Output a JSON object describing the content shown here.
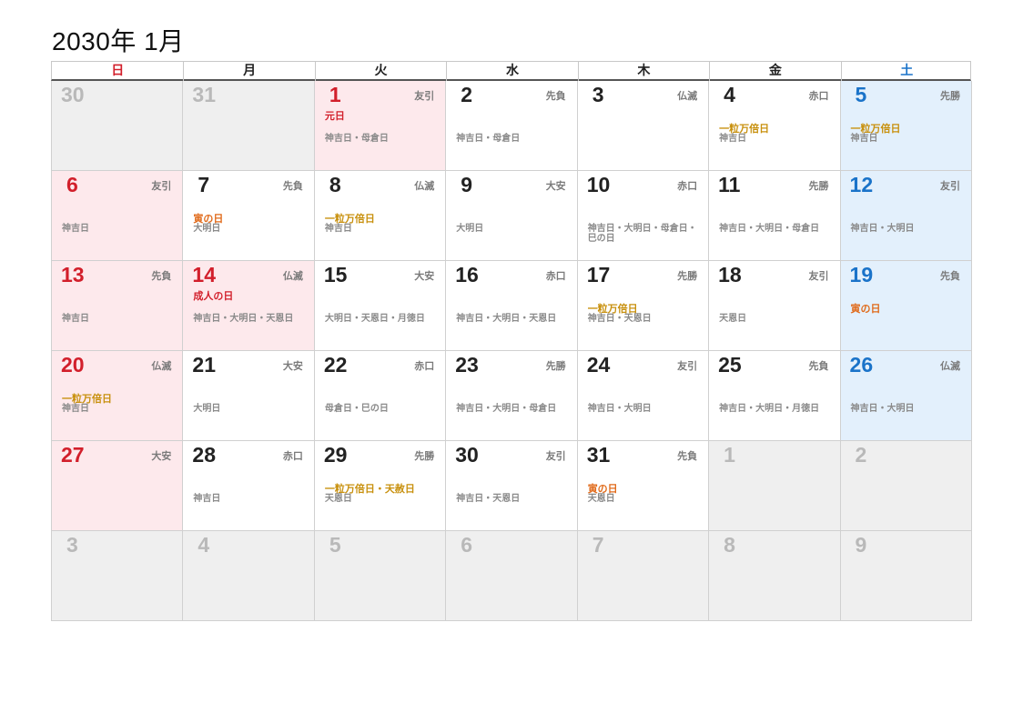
{
  "title": "2030年 1月",
  "weekdays": [
    "日",
    "月",
    "火",
    "水",
    "木",
    "金",
    "土"
  ],
  "cells": [
    {
      "day": "30",
      "type": "other",
      "rokuyo": "",
      "holiday": "",
      "tag": "",
      "tag_color": "",
      "notes": ""
    },
    {
      "day": "31",
      "type": "other",
      "rokuyo": "",
      "holiday": "",
      "tag": "",
      "tag_color": "",
      "notes": ""
    },
    {
      "day": "1",
      "type": "holiday",
      "rokuyo": "友引",
      "holiday": "元日",
      "tag": "",
      "tag_color": "",
      "notes": "神吉日・母倉日"
    },
    {
      "day": "2",
      "type": "normal",
      "rokuyo": "先負",
      "holiday": "",
      "tag": "",
      "tag_color": "",
      "notes": "神吉日・母倉日"
    },
    {
      "day": "3",
      "type": "normal",
      "rokuyo": "仏滅",
      "holiday": "",
      "tag": "",
      "tag_color": "",
      "notes": ""
    },
    {
      "day": "4",
      "type": "normal",
      "rokuyo": "赤口",
      "holiday": "",
      "tag": "一粒万倍日",
      "tag_color": "gold",
      "notes": "神吉日"
    },
    {
      "day": "5",
      "type": "saturday",
      "rokuyo": "先勝",
      "holiday": "",
      "tag": "一粒万倍日",
      "tag_color": "gold",
      "notes": "神吉日"
    },
    {
      "day": "6",
      "type": "sunday",
      "rokuyo": "友引",
      "holiday": "",
      "tag": "",
      "tag_color": "",
      "notes": "神吉日"
    },
    {
      "day": "7",
      "type": "normal",
      "rokuyo": "先負",
      "holiday": "",
      "tag": "寅の日",
      "tag_color": "orange",
      "notes": "大明日"
    },
    {
      "day": "8",
      "type": "normal",
      "rokuyo": "仏滅",
      "holiday": "",
      "tag": "一粒万倍日",
      "tag_color": "gold",
      "notes": "神吉日"
    },
    {
      "day": "9",
      "type": "normal",
      "rokuyo": "大安",
      "holiday": "",
      "tag": "",
      "tag_color": "",
      "notes": "大明日"
    },
    {
      "day": "10",
      "type": "normal",
      "rokuyo": "赤口",
      "holiday": "",
      "tag": "",
      "tag_color": "",
      "notes": "神吉日・大明日・母倉日・巳の日"
    },
    {
      "day": "11",
      "type": "normal",
      "rokuyo": "先勝",
      "holiday": "",
      "tag": "",
      "tag_color": "",
      "notes": "神吉日・大明日・母倉日"
    },
    {
      "day": "12",
      "type": "saturday",
      "rokuyo": "友引",
      "holiday": "",
      "tag": "",
      "tag_color": "",
      "notes": "神吉日・大明日"
    },
    {
      "day": "13",
      "type": "sunday",
      "rokuyo": "先負",
      "holiday": "",
      "tag": "",
      "tag_color": "",
      "notes": "神吉日"
    },
    {
      "day": "14",
      "type": "holiday",
      "rokuyo": "仏滅",
      "holiday": "成人の日",
      "tag": "",
      "tag_color": "",
      "notes": "神吉日・大明日・天恩日"
    },
    {
      "day": "15",
      "type": "normal",
      "rokuyo": "大安",
      "holiday": "",
      "tag": "",
      "tag_color": "",
      "notes": "大明日・天恩日・月徳日"
    },
    {
      "day": "16",
      "type": "normal",
      "rokuyo": "赤口",
      "holiday": "",
      "tag": "",
      "tag_color": "",
      "notes": "神吉日・大明日・天恩日"
    },
    {
      "day": "17",
      "type": "normal",
      "rokuyo": "先勝",
      "holiday": "",
      "tag": "一粒万倍日",
      "tag_color": "gold",
      "notes": "神吉日・天恩日"
    },
    {
      "day": "18",
      "type": "normal",
      "rokuyo": "友引",
      "holiday": "",
      "tag": "",
      "tag_color": "",
      "notes": "天恩日"
    },
    {
      "day": "19",
      "type": "saturday",
      "rokuyo": "先負",
      "holiday": "",
      "tag": "寅の日",
      "tag_color": "orange",
      "notes": ""
    },
    {
      "day": "20",
      "type": "sunday",
      "rokuyo": "仏滅",
      "holiday": "",
      "tag": "一粒万倍日",
      "tag_color": "gold",
      "notes": "神吉日"
    },
    {
      "day": "21",
      "type": "normal",
      "rokuyo": "大安",
      "holiday": "",
      "tag": "",
      "tag_color": "",
      "notes": "大明日"
    },
    {
      "day": "22",
      "type": "normal",
      "rokuyo": "赤口",
      "holiday": "",
      "tag": "",
      "tag_color": "",
      "notes": "母倉日・巳の日"
    },
    {
      "day": "23",
      "type": "normal",
      "rokuyo": "先勝",
      "holiday": "",
      "tag": "",
      "tag_color": "",
      "notes": "神吉日・大明日・母倉日"
    },
    {
      "day": "24",
      "type": "normal",
      "rokuyo": "友引",
      "holiday": "",
      "tag": "",
      "tag_color": "",
      "notes": "神吉日・大明日"
    },
    {
      "day": "25",
      "type": "normal",
      "rokuyo": "先負",
      "holiday": "",
      "tag": "",
      "tag_color": "",
      "notes": "神吉日・大明日・月徳日"
    },
    {
      "day": "26",
      "type": "saturday",
      "rokuyo": "仏滅",
      "holiday": "",
      "tag": "",
      "tag_color": "",
      "notes": "神吉日・大明日"
    },
    {
      "day": "27",
      "type": "sunday",
      "rokuyo": "大安",
      "holiday": "",
      "tag": "",
      "tag_color": "",
      "notes": ""
    },
    {
      "day": "28",
      "type": "normal",
      "rokuyo": "赤口",
      "holiday": "",
      "tag": "",
      "tag_color": "",
      "notes": "神吉日"
    },
    {
      "day": "29",
      "type": "normal",
      "rokuyo": "先勝",
      "holiday": "",
      "tag": "一粒万倍日・天赦日",
      "tag_color": "gold",
      "notes": "天恩日"
    },
    {
      "day": "30",
      "type": "normal",
      "rokuyo": "友引",
      "holiday": "",
      "tag": "",
      "tag_color": "",
      "notes": "神吉日・天恩日"
    },
    {
      "day": "31",
      "type": "normal",
      "rokuyo": "先負",
      "holiday": "",
      "tag": "寅の日",
      "tag_color": "orange",
      "notes": "天恩日"
    },
    {
      "day": "1",
      "type": "other",
      "rokuyo": "",
      "holiday": "",
      "tag": "",
      "tag_color": "",
      "notes": ""
    },
    {
      "day": "2",
      "type": "other",
      "rokuyo": "",
      "holiday": "",
      "tag": "",
      "tag_color": "",
      "notes": ""
    },
    {
      "day": "3",
      "type": "other",
      "rokuyo": "",
      "holiday": "",
      "tag": "",
      "tag_color": "",
      "notes": ""
    },
    {
      "day": "4",
      "type": "other",
      "rokuyo": "",
      "holiday": "",
      "tag": "",
      "tag_color": "",
      "notes": ""
    },
    {
      "day": "5",
      "type": "other",
      "rokuyo": "",
      "holiday": "",
      "tag": "",
      "tag_color": "",
      "notes": ""
    },
    {
      "day": "6",
      "type": "other",
      "rokuyo": "",
      "holiday": "",
      "tag": "",
      "tag_color": "",
      "notes": ""
    },
    {
      "day": "7",
      "type": "other",
      "rokuyo": "",
      "holiday": "",
      "tag": "",
      "tag_color": "",
      "notes": ""
    },
    {
      "day": "8",
      "type": "other",
      "rokuyo": "",
      "holiday": "",
      "tag": "",
      "tag_color": "",
      "notes": ""
    },
    {
      "day": "9",
      "type": "other",
      "rokuyo": "",
      "holiday": "",
      "tag": "",
      "tag_color": "",
      "notes": ""
    }
  ]
}
